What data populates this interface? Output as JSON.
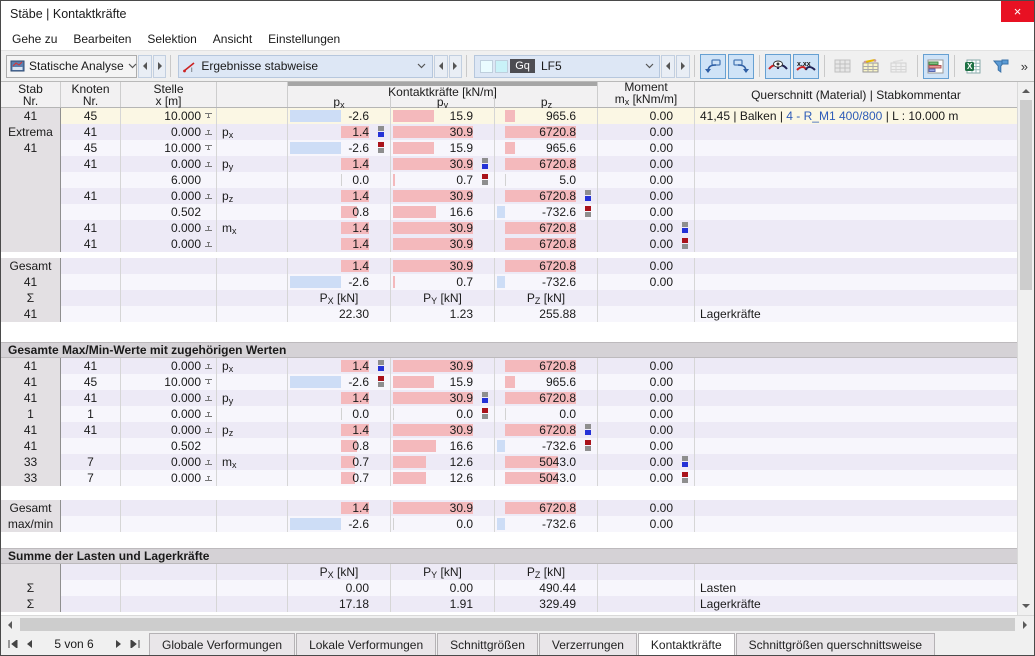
{
  "window": {
    "title": "Stäbe | Kontaktkräfte",
    "close_glyph": "×"
  },
  "menu": {
    "items": [
      "Gehe zu",
      "Bearbeiten",
      "Selektion",
      "Ansicht",
      "Einstellungen"
    ]
  },
  "toolbar": {
    "analysis_combo": {
      "label": "Statische Analyse",
      "icon": "static-analysis-icon"
    },
    "results_combo": {
      "label": "Ergebnisse stabweise",
      "icon": "results-by-member-icon"
    },
    "loadcase_combo": {
      "badge": "Gq",
      "label": "LF5",
      "icon": "loadcase-colors-icon"
    },
    "buttons": [
      {
        "name": "undo",
        "active": true
      },
      {
        "name": "redo",
        "active": true
      },
      {
        "name": "sep"
      },
      {
        "name": "show-values",
        "active": true
      },
      {
        "name": "decimal-places",
        "active": true
      },
      {
        "name": "sep"
      },
      {
        "name": "table-grid",
        "disabled": true
      },
      {
        "name": "table-edit"
      },
      {
        "name": "table-plain",
        "disabled": true
      },
      {
        "name": "sep"
      },
      {
        "name": "result-diagrams",
        "active": true
      },
      {
        "name": "sep"
      },
      {
        "name": "excel-export"
      },
      {
        "name": "filter"
      }
    ],
    "overflow_glyph": "»"
  },
  "colors": {
    "bar_pos": "#f4b9bc",
    "bar_neg": "#cdddf6",
    "bar_zero": "#d2d2d2",
    "mark_max_top": "#8e8e8e",
    "mark_max_bottom": "#2431d6",
    "mark_min_top": "#a9121a",
    "mark_min_bottom": "#8e8e8e",
    "link_text": "#2e5cb8",
    "row_cream": "#fbf7e4",
    "row_lav": "#edeaf6",
    "row_white": "#f7f6fc"
  },
  "table": {
    "headers": {
      "stab": [
        "Stab",
        "Nr."
      ],
      "knoten": [
        "Knoten",
        "Nr."
      ],
      "stelle": [
        "Stelle",
        "x [m]"
      ],
      "group": "Kontaktkräfte [kN/m]",
      "px": [
        "p",
        "x"
      ],
      "py": [
        "p",
        "y"
      ],
      "pz": [
        "p",
        "z"
      ],
      "moment_line1": "Moment",
      "moment_base": "m",
      "moment_sub": "x",
      "moment_unit": " [kNm/m]",
      "querschnitt": "Querschnitt (Material) | Stabkommentar"
    },
    "labels": {
      "px": [
        "p",
        "x"
      ],
      "py": [
        "p",
        "y"
      ],
      "pz": [
        "p",
        "z"
      ],
      "mx": [
        "m",
        "x"
      ]
    },
    "sumhead": {
      "px": [
        "P",
        "X",
        " [kN]"
      ],
      "py": [
        "P",
        "Y",
        " [kN]"
      ],
      "pz": [
        "P",
        "Z",
        " [kN]"
      ]
    },
    "sections": [
      {
        "rows": [
          {
            "s": "41",
            "k": "45",
            "x": "10.000",
            "xm": "e",
            "px": "-2.6",
            "py": "15.9",
            "pz": "965.6",
            "mx": "0.00",
            "bg": "cream",
            "cm": [
              {
                "t": "41,45 | Balken | "
              },
              {
                "t": "4 - R_M1 400/800",
                "c": "link"
              },
              {
                "t": " | L : 10.000 m"
              }
            ]
          },
          {
            "s": "Extrema",
            "k": "41",
            "x": "0.000",
            "xm": "s",
            "l": "px",
            "px": "1.4",
            "py": "30.9",
            "pz": "6720.8",
            "mx": "0.00",
            "mk": {
              "col": "px",
              "t": "max"
            },
            "bg": "lav"
          },
          {
            "s": "41",
            "k": "45",
            "x": "10.000",
            "xm": "e",
            "px": "-2.6",
            "py": "15.9",
            "pz": "965.6",
            "mx": "0.00",
            "mk": {
              "col": "px",
              "t": "min"
            },
            "bg": "white"
          },
          {
            "k": "41",
            "x": "0.000",
            "xm": "s",
            "l": "py",
            "px": "1.4",
            "py": "30.9",
            "pz": "6720.8",
            "mx": "0.00",
            "mk": {
              "col": "py",
              "t": "max"
            },
            "bg": "lav"
          },
          {
            "x": "6.000",
            "px": "0.0",
            "py": "0.7",
            "pz": "5.0",
            "mx": "0.00",
            "mk": {
              "col": "py",
              "t": "min"
            },
            "bg": "white"
          },
          {
            "k": "41",
            "x": "0.000",
            "xm": "s",
            "l": "pz",
            "px": "1.4",
            "py": "30.9",
            "pz": "6720.8",
            "mx": "0.00",
            "mk": {
              "col": "pz",
              "t": "max"
            },
            "bg": "lav"
          },
          {
            "x": "0.502",
            "px": "0.8",
            "py": "16.6",
            "pz": "-732.6",
            "mx": "0.00",
            "mk": {
              "col": "pz",
              "t": "min"
            },
            "bg": "white"
          },
          {
            "k": "41",
            "x": "0.000",
            "xm": "s",
            "l": "mx",
            "px": "1.4",
            "py": "30.9",
            "pz": "6720.8",
            "mx": "0.00",
            "mk": {
              "col": "mx",
              "t": "max"
            },
            "bg": "lav"
          },
          {
            "k": "41",
            "x": "0.000",
            "xm": "s",
            "px": "1.4",
            "py": "30.9",
            "pz": "6720.8",
            "mx": "0.00",
            "mk": {
              "col": "mx",
              "t": "min"
            },
            "bg": "lav"
          }
        ]
      },
      {
        "gap": 6,
        "rows": [
          {
            "s": "Gesamt",
            "px": "1.4",
            "py": "30.9",
            "pz": "6720.8",
            "mx": "0.00",
            "bg": "lav"
          },
          {
            "s": "41",
            "px": "-2.6",
            "py": "0.7",
            "pz": "-732.6",
            "mx": "0.00",
            "bg": "white"
          },
          {
            "s": "Σ",
            "type": "sh",
            "bg": "lav"
          },
          {
            "s": "41",
            "type": "pl",
            "px": "22.30",
            "py": "1.23",
            "pz": "255.88",
            "cm": [
              {
                "t": "Lagerkräfte"
              }
            ],
            "bg": "white"
          }
        ]
      },
      {
        "gap": 20,
        "title": "Gesamte Max/Min-Werte mit zugehörigen Werten",
        "rows": [
          {
            "s": "41",
            "k": "41",
            "x": "0.000",
            "xm": "s",
            "l": "px",
            "px": "1.4",
            "py": "30.9",
            "pz": "6720.8",
            "mx": "0.00",
            "mk": {
              "col": "px",
              "t": "max"
            },
            "bg": "lav"
          },
          {
            "s": "41",
            "k": "45",
            "x": "10.000",
            "xm": "e",
            "px": "-2.6",
            "py": "15.9",
            "pz": "965.6",
            "mx": "0.00",
            "mk": {
              "col": "px",
              "t": "min"
            },
            "bg": "white"
          },
          {
            "s": "41",
            "k": "41",
            "x": "0.000",
            "xm": "s",
            "l": "py",
            "px": "1.4",
            "py": "30.9",
            "pz": "6720.8",
            "mx": "0.00",
            "mk": {
              "col": "py",
              "t": "max"
            },
            "bg": "lav"
          },
          {
            "s": "1",
            "k": "1",
            "x": "0.000",
            "xm": "s",
            "px": "0.0",
            "py": "0.0",
            "pz": "0.0",
            "mx": "0.00",
            "mk": {
              "col": "py",
              "t": "min"
            },
            "bg": "white"
          },
          {
            "s": "41",
            "k": "41",
            "x": "0.000",
            "xm": "s",
            "l": "pz",
            "px": "1.4",
            "py": "30.9",
            "pz": "6720.8",
            "mx": "0.00",
            "mk": {
              "col": "pz",
              "t": "max"
            },
            "bg": "lav"
          },
          {
            "s": "41",
            "x": "0.502",
            "px": "0.8",
            "py": "16.6",
            "pz": "-732.6",
            "mx": "0.00",
            "mk": {
              "col": "pz",
              "t": "min"
            },
            "bg": "white"
          },
          {
            "s": "33",
            "k": "7",
            "x": "0.000",
            "xm": "s",
            "l": "mx",
            "px": "0.7",
            "py": "12.6",
            "pz": "5043.0",
            "mx": "0.00",
            "mk": {
              "col": "mx",
              "t": "max"
            },
            "bg": "lav"
          },
          {
            "s": "33",
            "k": "7",
            "x": "0.000",
            "xm": "s",
            "px": "0.7",
            "py": "12.6",
            "pz": "5043.0",
            "mx": "0.00",
            "mk": {
              "col": "mx",
              "t": "min"
            },
            "bg": "white"
          }
        ]
      },
      {
        "gap": 14,
        "rows": [
          {
            "s": "Gesamt",
            "px": "1.4",
            "py": "30.9",
            "pz": "6720.8",
            "mx": "0.00",
            "bg": "lav"
          },
          {
            "s": "max/min",
            "px": "-2.6",
            "py": "0.0",
            "pz": "-732.6",
            "mx": "0.00",
            "bg": "white"
          }
        ]
      },
      {
        "gap": 16,
        "title": "Summe der Lasten und Lagerkräfte",
        "rows": [
          {
            "type": "sh",
            "bg": "lav"
          },
          {
            "s": "Σ",
            "type": "pl",
            "px": "0.00",
            "py": "0.00",
            "pz": "490.44",
            "cm": [
              {
                "t": "Lasten"
              }
            ],
            "bg": "white"
          },
          {
            "s": "Σ",
            "type": "pl",
            "px": "17.18",
            "py": "1.91",
            "pz": "329.49",
            "cm": [
              {
                "t": "Lagerkräfte"
              }
            ],
            "bg": "lav"
          }
        ]
      }
    ]
  },
  "statusbar": {
    "page": "5 von 6",
    "tabs": [
      {
        "label": "Globale Verformungen"
      },
      {
        "label": "Lokale Verformungen"
      },
      {
        "label": "Schnittgrößen"
      },
      {
        "label": "Verzerrungen"
      },
      {
        "label": "Kontaktkräfte",
        "active": true
      },
      {
        "label": "Schnittgrößen querschnittsweise"
      }
    ]
  }
}
